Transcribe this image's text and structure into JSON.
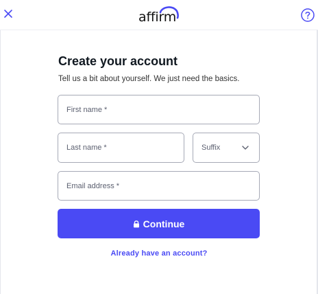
{
  "header": {
    "logo_text": "affirm",
    "close_icon": "close-icon",
    "help_icon": "help-circle-icon"
  },
  "form": {
    "title": "Create your account",
    "subtitle": "Tell us a bit about yourself. We just need the basics.",
    "first_name_placeholder": "First name *",
    "last_name_placeholder": "Last name *",
    "suffix_label": "Suffix",
    "email_placeholder": "Email address *",
    "continue_label": "Continue",
    "signin_link": "Already have an account?"
  },
  "colors": {
    "accent": "#4a4af4",
    "text": "#101820",
    "border": "#a6a9b6"
  }
}
